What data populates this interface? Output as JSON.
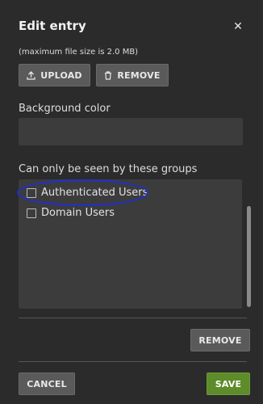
{
  "dialog": {
    "title": "Edit entry",
    "close_icon": "close-icon",
    "close_glyph": "✕"
  },
  "file": {
    "note": "(maximum file size is 2.0 MB)",
    "upload_label": "UPLOAD",
    "upload_icon": "upload-icon",
    "remove_label": "REMOVE",
    "remove_icon": "trash-icon"
  },
  "background_color": {
    "label": "Background color",
    "value": ""
  },
  "groups": {
    "label": "Can only be seen by these groups",
    "items": [
      {
        "label": "Authenticated Users",
        "checked": false
      },
      {
        "label": "Domain Users",
        "checked": false
      }
    ],
    "highlight_color": "#1d2fd6"
  },
  "actions": {
    "remove_label": "REMOVE",
    "cancel_label": "CANCEL",
    "save_label": "SAVE",
    "save_color": "#5e8c2a"
  }
}
